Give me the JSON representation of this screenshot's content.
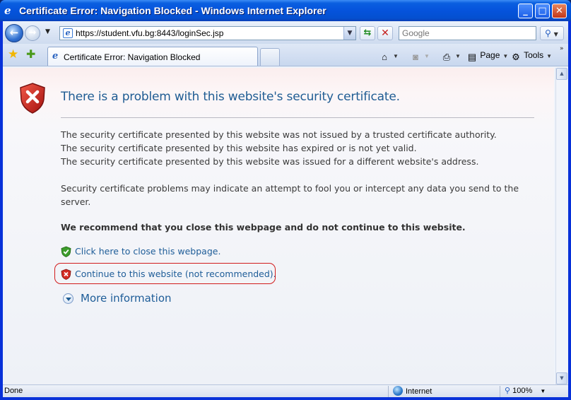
{
  "window": {
    "title": "Certificate Error: Navigation Blocked - Windows Internet Explorer",
    "minimize_icon": "minimize-icon",
    "maximize_icon": "maximize-icon",
    "close_icon": "close-icon"
  },
  "navbar": {
    "address": "https://student.vfu.bg:8443/loginSec.jsp",
    "search_placeholder": "Google"
  },
  "tabs": [
    {
      "label": "Certificate Error: Navigation Blocked",
      "active": true
    }
  ],
  "commandbar": {
    "page_label": "Page",
    "tools_label": "Tools"
  },
  "content": {
    "heading": "There is a problem with this website's security certificate.",
    "reasons": [
      "The security certificate presented by this website was not issued by a trusted certificate authority.",
      "The security certificate presented by this website has expired or is not yet valid.",
      "The security certificate presented by this website was issued for a different website's address."
    ],
    "warning_line1": "Security certificate problems may indicate an attempt to fool you or intercept any data you send to the",
    "warning_line2": "server.",
    "recommendation": "We recommend that you close this webpage and do not continue to this website.",
    "close_link": "Click here to close this webpage.",
    "continue_link": "Continue to this website (not recommended).",
    "more_info": "More information"
  },
  "statusbar": {
    "status": "Done",
    "zone": "Internet",
    "zoom": "100%"
  },
  "colors": {
    "titlebar": "#0553dc",
    "heading": "#1f5c93",
    "link": "#1e5d98",
    "highlight_border": "#d21c1c"
  }
}
